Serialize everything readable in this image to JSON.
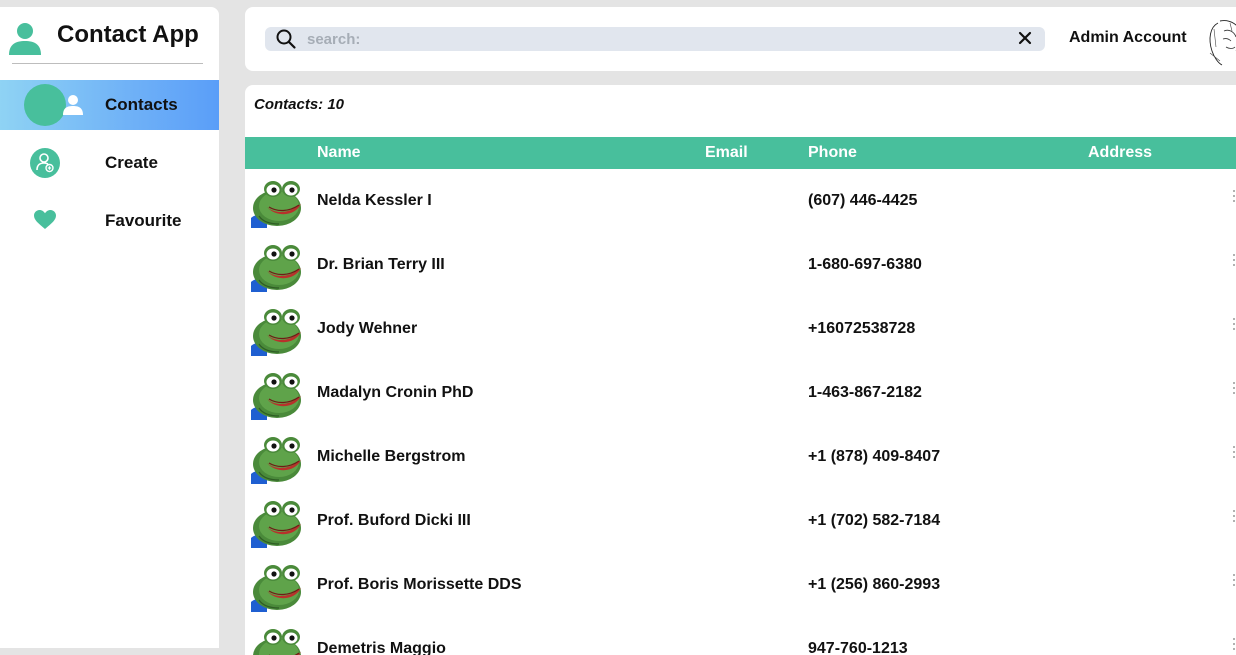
{
  "app": {
    "title": "Contact App"
  },
  "sidebar": {
    "items": [
      {
        "label": "Contacts",
        "icon": "contacts-icon",
        "active": true
      },
      {
        "label": "Create",
        "icon": "add-user-icon",
        "active": false
      },
      {
        "label": "Favourite",
        "icon": "heart-icon",
        "active": false
      }
    ]
  },
  "header": {
    "search": {
      "placeholder": "search:",
      "value": ""
    },
    "account_name": "Admin Account"
  },
  "contacts": {
    "count_label": "Contacts: 10",
    "columns": [
      "Name",
      "Email",
      "Phone",
      "Address"
    ],
    "rows": [
      {
        "name": "Nelda Kessler I",
        "email": "",
        "phone": "(607) 446-4425",
        "address": ""
      },
      {
        "name": "Dr. Brian Terry III",
        "email": "",
        "phone": "1-680-697-6380",
        "address": ""
      },
      {
        "name": "Jody Wehner",
        "email": "",
        "phone": "+16072538728",
        "address": ""
      },
      {
        "name": "Madalyn Cronin PhD",
        "email": "",
        "phone": "1-463-867-2182",
        "address": ""
      },
      {
        "name": "Michelle Bergstrom",
        "email": "",
        "phone": "+1 (878) 409-8407",
        "address": ""
      },
      {
        "name": "Prof. Buford Dicki III",
        "email": "",
        "phone": "+1 (702) 582-7184",
        "address": ""
      },
      {
        "name": "Prof. Boris Morissette DDS",
        "email": "",
        "phone": "+1 (256) 860-2993",
        "address": ""
      },
      {
        "name": "Demetris Maggio",
        "email": "",
        "phone": "947-760-1213",
        "address": ""
      }
    ]
  },
  "colors": {
    "accent": "#48bf9c",
    "active_gradient_start": "#8fd3f4",
    "active_gradient_end": "#5a9ef8"
  }
}
